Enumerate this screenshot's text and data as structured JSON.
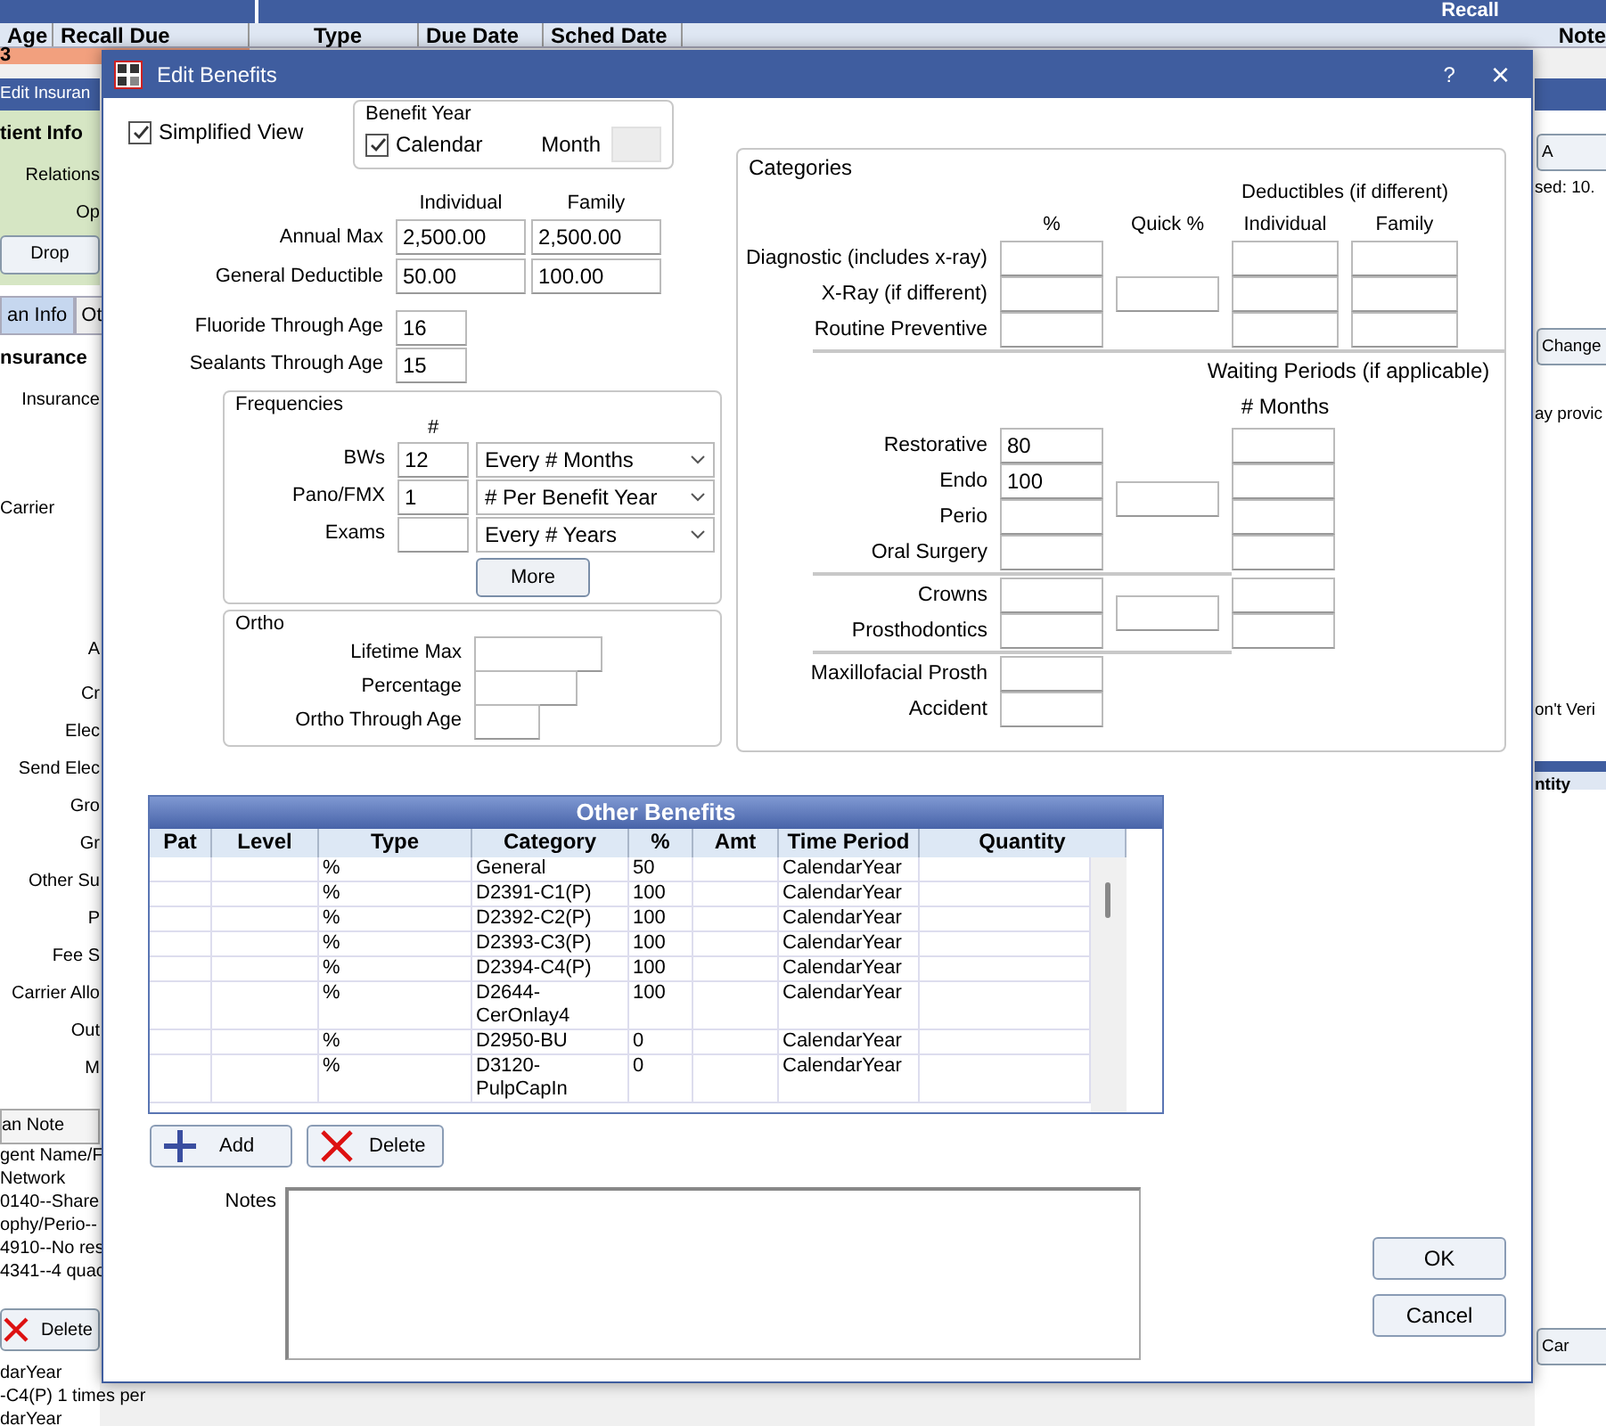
{
  "background": {
    "patient_columns": [
      "Age",
      "Recall Due"
    ],
    "patient_row": "3",
    "recall_title": "Recall",
    "recall_columns": [
      "Type",
      "Due Date",
      "Sched Date",
      "Note"
    ],
    "left_window": {
      "title": "Edit Insuran",
      "items": [
        {
          "kind": "heading",
          "text": "tient Info"
        },
        {
          "kind": "label",
          "text": "Relations"
        },
        {
          "kind": "label",
          "text": "Op"
        },
        {
          "kind": "button",
          "text": "Drop"
        },
        {
          "kind": "tabs",
          "tabs": [
            {
              "text": "an Info",
              "selected": true
            },
            {
              "text": "Ot",
              "selected": false
            }
          ]
        },
        {
          "kind": "heading",
          "text": "nsurance"
        },
        {
          "kind": "label",
          "text": "Insurance"
        },
        {
          "kind": "left",
          "text": "Carrier"
        },
        {
          "kind": "label",
          "text": "A"
        },
        {
          "kind": "label",
          "text": "Cr"
        },
        {
          "kind": "label",
          "text": "Elec"
        },
        {
          "kind": "label",
          "text": "Send Elec"
        },
        {
          "kind": "label",
          "text": "Gro"
        },
        {
          "kind": "label",
          "text": "Gr"
        },
        {
          "kind": "label",
          "text": "Other Su"
        },
        {
          "kind": "label",
          "text": "P"
        },
        {
          "kind": "label",
          "text": "Fee S"
        },
        {
          "kind": "label",
          "text": "Carrier Allo"
        },
        {
          "kind": "label",
          "text": "Out"
        },
        {
          "kind": "label",
          "text": "M"
        },
        {
          "kind": "note_header",
          "text": "an Note"
        },
        {
          "kind": "line",
          "text": "gent Name/F"
        },
        {
          "kind": "line",
          "text": "Network"
        },
        {
          "kind": "line",
          "text": "0140--Share"
        },
        {
          "kind": "line",
          "text": "ophy/Perio--"
        },
        {
          "kind": "line",
          "text": "4910--No res"
        },
        {
          "kind": "line",
          "text": "4341--4 quac"
        },
        {
          "kind": "delete",
          "text": "Delete"
        },
        {
          "kind": "line",
          "text": "darYear"
        },
        {
          "kind": "line",
          "text": "-C4(P) 1 times per"
        },
        {
          "kind": "line",
          "text": "darYear"
        }
      ]
    },
    "right_window": {
      "items": [
        {
          "kind": "button",
          "text": "A"
        },
        {
          "kind": "label",
          "text": "sed:  10."
        },
        {
          "kind": "button",
          "text": "Change"
        },
        {
          "kind": "label",
          "text": "ay provic"
        },
        {
          "kind": "label",
          "text": "on't Veri"
        },
        {
          "kind": "header",
          "text": "ntity"
        },
        {
          "kind": "button",
          "text": "Car"
        }
      ]
    }
  },
  "dialog": {
    "title": "Edit Benefits",
    "help": "?",
    "close": "×",
    "simplified_view": {
      "label": "Simplified View",
      "checked": true
    },
    "benefit_year": {
      "title": "Benefit Year",
      "calendar": {
        "label": "Calendar",
        "checked": true
      },
      "month_label": "Month",
      "month_disabled": true
    },
    "amounts": {
      "columns": [
        "Individual",
        "Family"
      ],
      "rows": [
        {
          "label": "Annual Max",
          "values": [
            "2,500.00",
            "2,500.00"
          ]
        },
        {
          "label": "General Deductible",
          "values": [
            "50.00",
            "100.00"
          ]
        }
      ]
    },
    "age_limits": [
      {
        "label": "Fluoride Through Age",
        "value": "16"
      },
      {
        "label": "Sealants Through Age",
        "value": "15"
      }
    ],
    "frequencies": {
      "title": "Frequencies",
      "count_header": "#",
      "more_button": "More",
      "rows": [
        {
          "label": "BWs",
          "count": "12",
          "period": "Every # Months"
        },
        {
          "label": "Pano/FMX",
          "count": "1",
          "period": "# Per Benefit Year"
        },
        {
          "label": "Exams",
          "period": "Every # Years"
        }
      ]
    },
    "ortho": {
      "title": "Ortho",
      "fields": [
        {
          "label": "Lifetime Max"
        },
        {
          "label": "Percentage"
        },
        {
          "label": "Ortho Through Age"
        }
      ]
    },
    "categories": {
      "title": "Categories",
      "deductibles_title": "Deductibles (if different)",
      "column_headers": [
        "%",
        "Quick %",
        "Individual",
        "Family"
      ],
      "waiting_title": "Waiting Periods (if applicable)",
      "months_header": "# Months",
      "groups": [
        {
          "kind": "deductible",
          "rows": [
            {
              "label": "Diagnostic (includes x-ray)"
            },
            {
              "label": "X-Ray (if different)"
            },
            {
              "label": "Routine Preventive"
            }
          ]
        },
        {
          "kind": "waiting",
          "rows": [
            {
              "label": "Restorative",
              "percent": "80"
            },
            {
              "label": "Endo",
              "percent": "100"
            },
            {
              "label": "Perio"
            },
            {
              "label": "Oral Surgery"
            }
          ]
        },
        {
          "kind": "waiting",
          "rows": [
            {
              "label": "Crowns"
            },
            {
              "label": "Prosthodontics"
            }
          ]
        },
        {
          "kind": "plain",
          "rows": [
            {
              "label": "Maxillofacial Prosth"
            },
            {
              "label": "Accident"
            }
          ]
        }
      ]
    },
    "other_benefits": {
      "title": "Other Benefits",
      "columns": [
        "Pat",
        "Level",
        "Type",
        "Category",
        "%",
        "Amt",
        "Time Period",
        "Quantity"
      ],
      "rows": [
        {
          "type": "%",
          "category": "General",
          "percent": "50",
          "time_period": "CalendarYear"
        },
        {
          "type": "%",
          "category": "D2391-C1(P)",
          "percent": "100",
          "time_period": "CalendarYear"
        },
        {
          "type": "%",
          "category": "D2392-C2(P)",
          "percent": "100",
          "time_period": "CalendarYear"
        },
        {
          "type": "%",
          "category": "D2393-C3(P)",
          "percent": "100",
          "time_period": "CalendarYear"
        },
        {
          "type": "%",
          "category": "D2394-C4(P)",
          "percent": "100",
          "time_period": "CalendarYear"
        },
        {
          "type": "%",
          "category": "D2644-CerOnlay4",
          "percent": "100",
          "time_period": "CalendarYear"
        },
        {
          "type": "%",
          "category": "D2950-BU",
          "percent": "0",
          "time_period": "CalendarYear"
        },
        {
          "type": "%",
          "category": "D3120-PulpCapIn",
          "percent": "0",
          "time_period": "CalendarYear"
        }
      ]
    },
    "add_button": "Add",
    "delete_button": "Delete",
    "notes_label": "Notes",
    "ok_button": "OK",
    "cancel_button": "Cancel"
  }
}
